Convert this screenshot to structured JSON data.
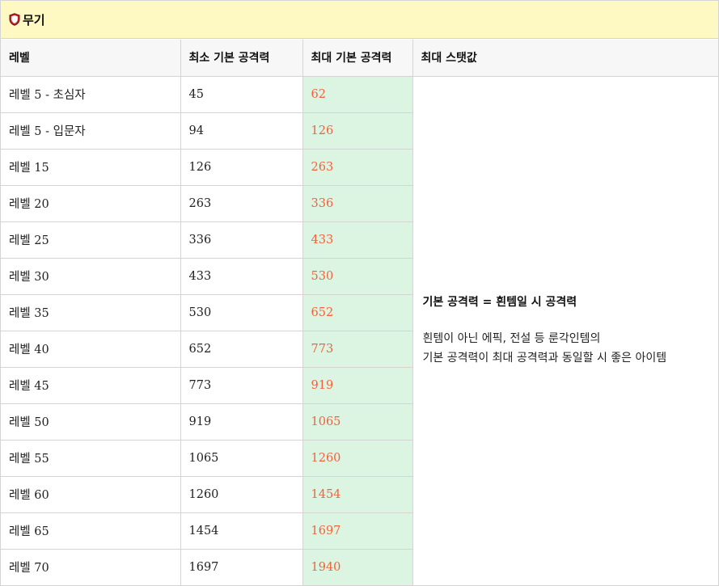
{
  "title": "무기",
  "icon": "shield-icon",
  "colors": {
    "header_bg": "#fef9c3",
    "max_attack_bg": "#dcf5e3",
    "max_attack_text": "#f0623d"
  },
  "columns": [
    "레벨",
    "최소 기본 공격력",
    "최대 기본 공격력",
    "최대 스탯값"
  ],
  "rows": [
    {
      "level": "레벨 5 - 초심자",
      "min": "45",
      "max": "62"
    },
    {
      "level": "레벨 5 - 입문자",
      "min": "94",
      "max": "126"
    },
    {
      "level": "레벨 15",
      "min": "126",
      "max": "263"
    },
    {
      "level": "레벨 20",
      "min": "263",
      "max": "336"
    },
    {
      "level": "레벨 25",
      "min": "336",
      "max": "433"
    },
    {
      "level": "레벨 30",
      "min": "433",
      "max": "530"
    },
    {
      "level": "레벨 35",
      "min": "530",
      "max": "652"
    },
    {
      "level": "레벨 40",
      "min": "652",
      "max": "773"
    },
    {
      "level": "레벨 45",
      "min": "773",
      "max": "919"
    },
    {
      "level": "레벨 50",
      "min": "919",
      "max": "1065"
    },
    {
      "level": "레벨 55",
      "min": "1065",
      "max": "1260"
    },
    {
      "level": "레벨 60",
      "min": "1260",
      "max": "1454"
    },
    {
      "level": "레벨 65",
      "min": "1454",
      "max": "1697"
    },
    {
      "level": "레벨 70",
      "min": "1697",
      "max": "1940"
    }
  ],
  "note": {
    "title": "기본 공격력 = 흰템일 시 공격력",
    "line1": "흰템이 아닌 에픽, 전설 등 룬각인템의",
    "line2": "기본 공격력이 최대 공격력과 동일할 시 좋은 아이템"
  }
}
